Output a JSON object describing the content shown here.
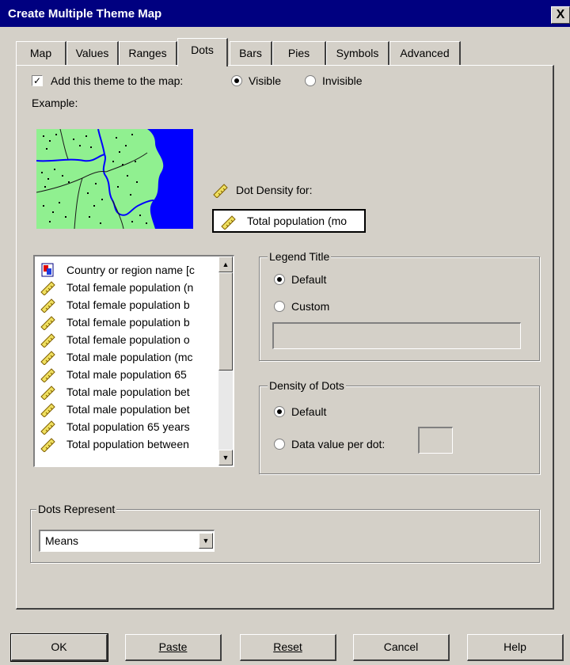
{
  "window": {
    "title": "Create Multiple Theme Map",
    "close_glyph": "X"
  },
  "tabs": [
    {
      "label": "Map"
    },
    {
      "label": "Values"
    },
    {
      "label": "Ranges"
    },
    {
      "label": "Dots",
      "active": true
    },
    {
      "label": "Bars"
    },
    {
      "label": "Pies"
    },
    {
      "label": "Symbols"
    },
    {
      "label": "Advanced"
    }
  ],
  "dots_tab": {
    "add_theme_label": "Add this theme to the map:",
    "add_theme_checked": true,
    "visibility": {
      "visible_label": "Visible",
      "invisible_label": "Invisible",
      "selected": "Visible"
    },
    "example_label": "Example:",
    "dot_density_for_label": "Dot Density for:",
    "dot_density_field_value": "Total population (mo",
    "variable_list": {
      "items": [
        {
          "label": "Country or region name [c",
          "icon": "nominal-variable-icon"
        },
        {
          "label": "Total female population (n",
          "icon": "scale-ruler-icon"
        },
        {
          "label": "Total female population b",
          "icon": "scale-ruler-icon"
        },
        {
          "label": "Total female population b",
          "icon": "scale-ruler-icon"
        },
        {
          "label": "Total female population o",
          "icon": "scale-ruler-icon"
        },
        {
          "label": "Total male population (mc",
          "icon": "scale-ruler-icon"
        },
        {
          "label": "Total male population 65 ",
          "icon": "scale-ruler-icon"
        },
        {
          "label": "Total male population bet",
          "icon": "scale-ruler-icon"
        },
        {
          "label": "Total male population bet",
          "icon": "scale-ruler-icon"
        },
        {
          "label": "Total population 65 years",
          "icon": "scale-ruler-icon"
        },
        {
          "label": "Total population between",
          "icon": "scale-ruler-icon"
        }
      ]
    },
    "legend_title": {
      "group_label": "Legend Title",
      "default_label": "Default",
      "custom_label": "Custom",
      "selected": "Default",
      "custom_value": ""
    },
    "density_of_dots": {
      "group_label": "Density of Dots",
      "default_label": "Default",
      "data_value_label": "Data value per dot:",
      "selected": "Default",
      "data_value": ""
    },
    "dots_represent": {
      "group_label": "Dots Represent",
      "selected_option": "Means"
    }
  },
  "buttons": {
    "ok": "OK",
    "paste": "Paste",
    "reset": "Reset",
    "cancel": "Cancel",
    "help": "Help"
  },
  "colors": {
    "title_bar": "#000080",
    "dialog_face": "#d4d0c8",
    "map_land": "#90f090",
    "map_water": "#0000ff"
  }
}
